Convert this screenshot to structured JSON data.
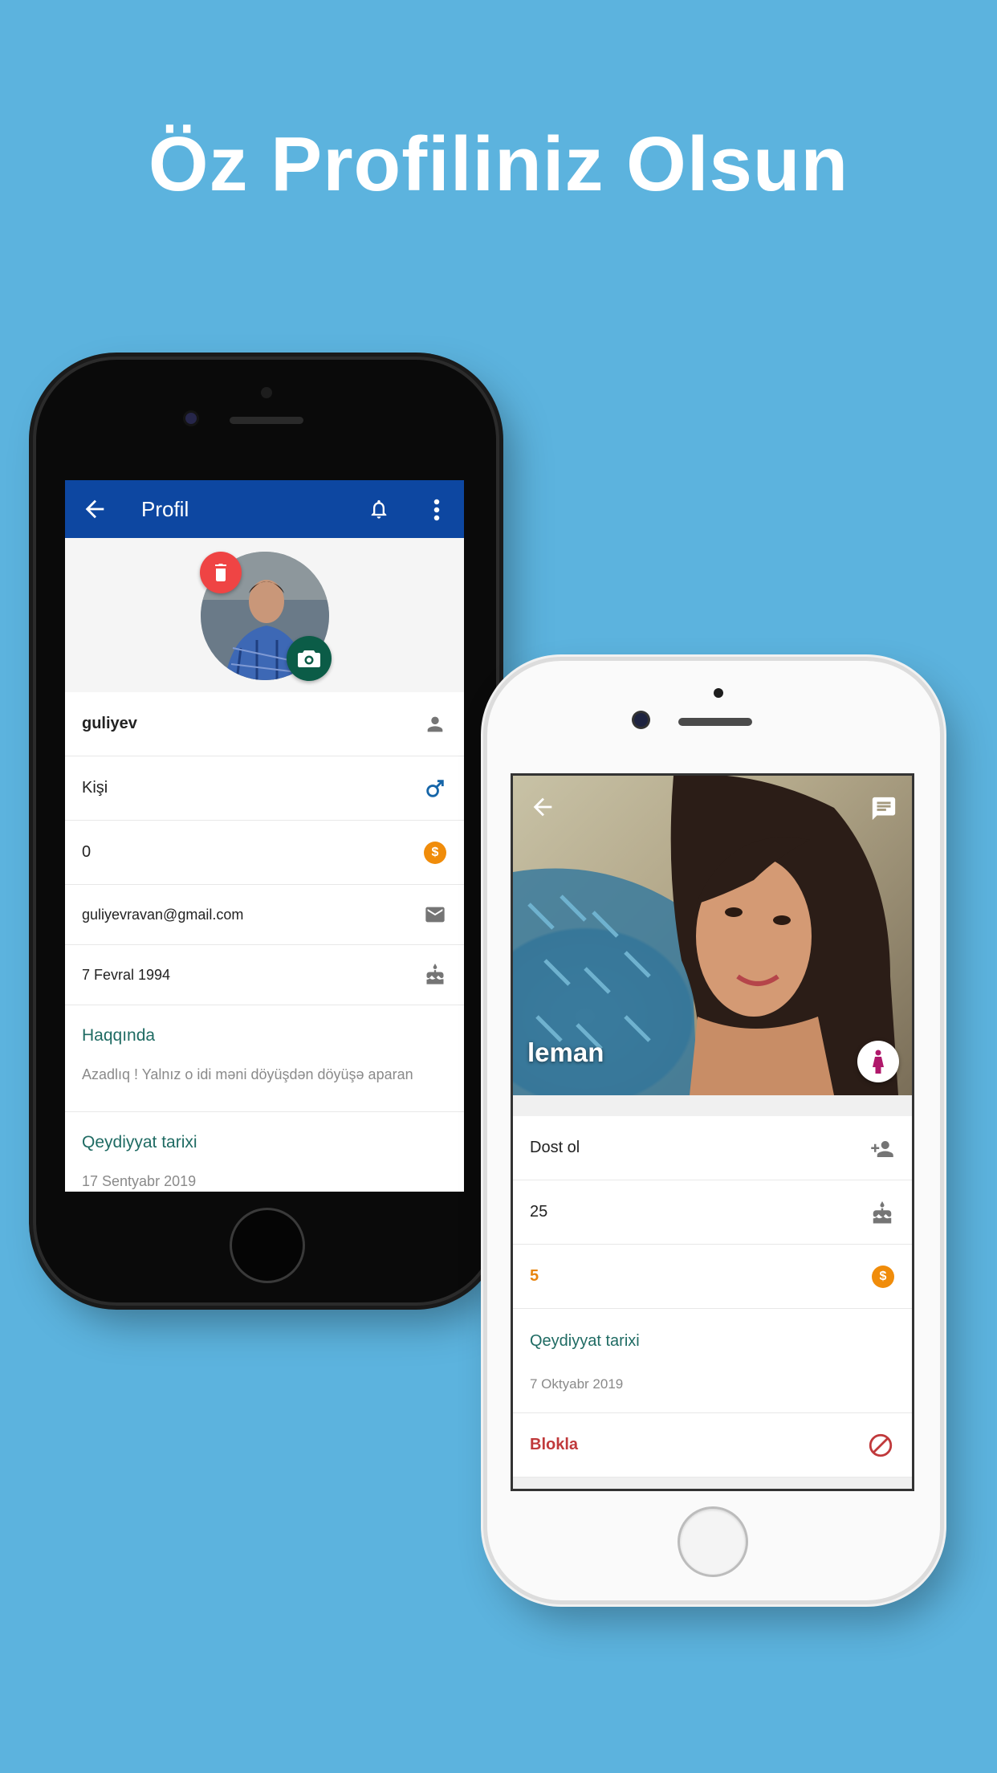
{
  "headline": "Öz Profiliniz Olsun",
  "left_phone": {
    "appbar": {
      "title": "Profil"
    },
    "rows": {
      "username": "guliyev",
      "gender": "Kişi",
      "coins": "0",
      "email": "guliyevravan@gmail.com",
      "birthday": "7 Fevral 1994"
    },
    "coin_symbol": "$",
    "about": {
      "title": "Haqqında",
      "text": "Azadlıq ! Yalnız o idi məni döyüşdən döyüşə aparan"
    },
    "registered": {
      "title": "Qeydiyyat tarixi",
      "date": "17 Sentyabr 2019"
    },
    "colors": {
      "appbar": "#0d47a1",
      "delete": "#ef4444",
      "camera": "#0b5c47",
      "section_title": "#1f6b63"
    }
  },
  "right_phone": {
    "profile_name": "leman",
    "rows": {
      "add_friend": "Dost ol",
      "age": "25",
      "coins": "5"
    },
    "coin_symbol": "$",
    "registered": {
      "title": "Qeydiyyat tarixi",
      "date": "7 Oktyabr 2019"
    },
    "block": "Blokla",
    "colors": {
      "coins": "#e8850f",
      "block": "#c0393b",
      "gender_icon": "#b0186b"
    }
  },
  "icons": [
    "back-arrow-icon",
    "bell-icon",
    "more-vert-icon",
    "delete-icon",
    "camera-icon",
    "person-icon",
    "male-icon",
    "coin-icon",
    "mail-icon",
    "cake-icon",
    "chat-icon",
    "female-icon",
    "person-add-icon",
    "block-icon"
  ]
}
